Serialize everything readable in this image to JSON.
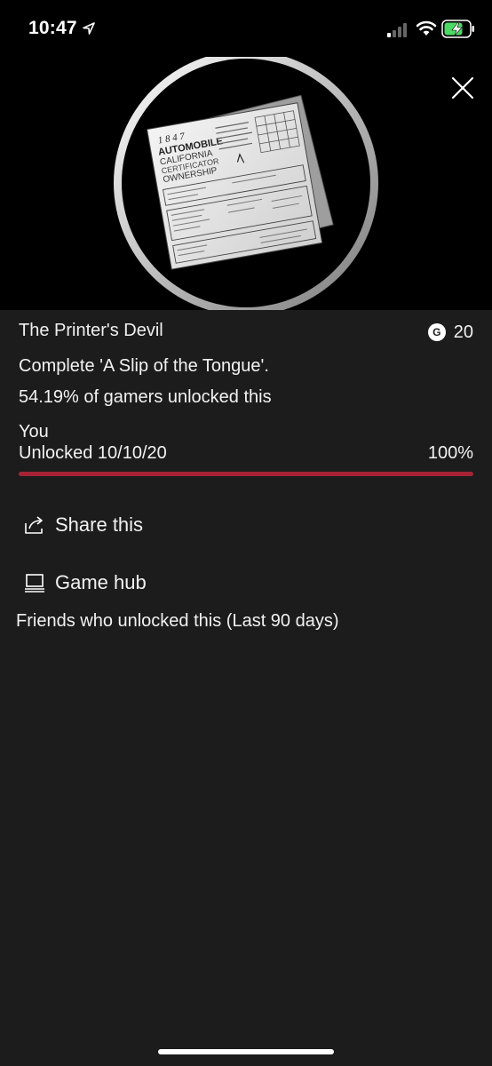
{
  "status_bar": {
    "time": "10:47"
  },
  "achievement": {
    "title": "The Printer's Devil",
    "gamerscore": "20",
    "description": "Complete 'A Slip of the Tongue'.",
    "rarity_text": "54.19% of gamers unlocked this",
    "you_label": "You",
    "unlocked_text": "Unlocked 10/10/20",
    "progress_text": "100%",
    "progress_fraction": 1.0
  },
  "badge_art_text": {
    "year": "1 8 4 7",
    "line1": "AUTOMOBILE",
    "line2": "CALIFORNIA",
    "line3": "CERTIFICATOR",
    "line4": "OWNERSHIP"
  },
  "actions": {
    "share_label": "Share this",
    "game_hub_label": "Game hub"
  },
  "friends_heading": "Friends who unlocked this (Last 90 days)",
  "colors": {
    "background": "#1c1c1c",
    "progress": "#a52334",
    "text": "#f2f2f2"
  }
}
